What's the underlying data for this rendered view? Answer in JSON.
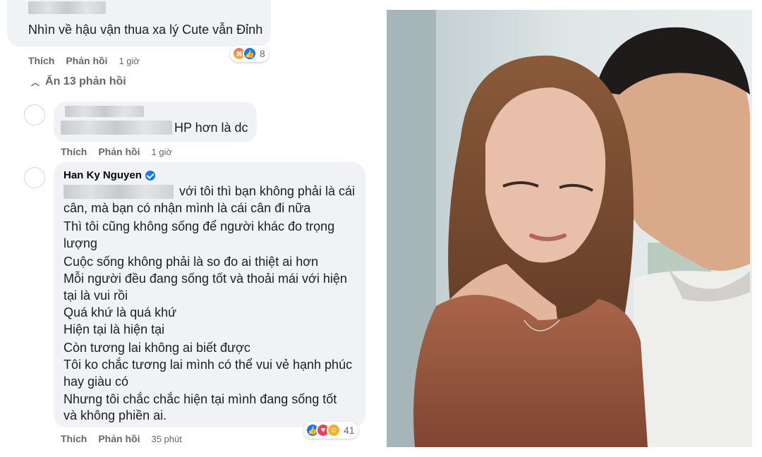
{
  "comment1": {
    "text": "Nhìn về hậu vận thua xa lý Cute vẫn Đỉnh",
    "actions": {
      "like": "Thích",
      "reply": "Phản hồi",
      "time": "1 giờ"
    },
    "reactions": {
      "icons": [
        "angry-icon",
        "like-icon"
      ],
      "count": "8"
    }
  },
  "hide_replies": {
    "label": "Ẩn 13 phản hồi"
  },
  "comment2": {
    "text": "HP hơn là dc",
    "actions": {
      "like": "Thích",
      "reply": "Phản hồi",
      "time": "1 giờ"
    }
  },
  "comment3": {
    "author": "Han Ky Nguyen",
    "lines": [
      "với tôi thì bạn không phải là cái",
      "cân, mà bạn có nhận mình là cái cân đi nữa",
      "Thì tôi cũng không sống để người khác đo trọng",
      "lượng",
      "Cuộc sống không phải là so đo ai thiệt ai hơn",
      "Mỗi người đều đang sống tốt và thoải mái với hiện",
      "tại là vui rồi",
      "Quá khứ là quá khứ",
      "Hiện tại là hiện tại",
      "Còn tương lai không ai biết được",
      "Tôi ko chắc tương lai mình có thể vui vẻ hạnh phúc",
      "hay giàu có",
      "Nhưng tôi chắc chắc hiện tại mình đang sống tốt",
      "và không phiền ai."
    ],
    "actions": {
      "like": "Thích",
      "reply": "Phản hồi",
      "time": "35 phút"
    },
    "reactions": {
      "icons": [
        "like-icon",
        "love-icon",
        "care-icon"
      ],
      "count": "41"
    }
  },
  "colors": {
    "bubble": "#f0f2f5",
    "link_blue": "#1877f2",
    "meta_gray": "#65676b"
  }
}
